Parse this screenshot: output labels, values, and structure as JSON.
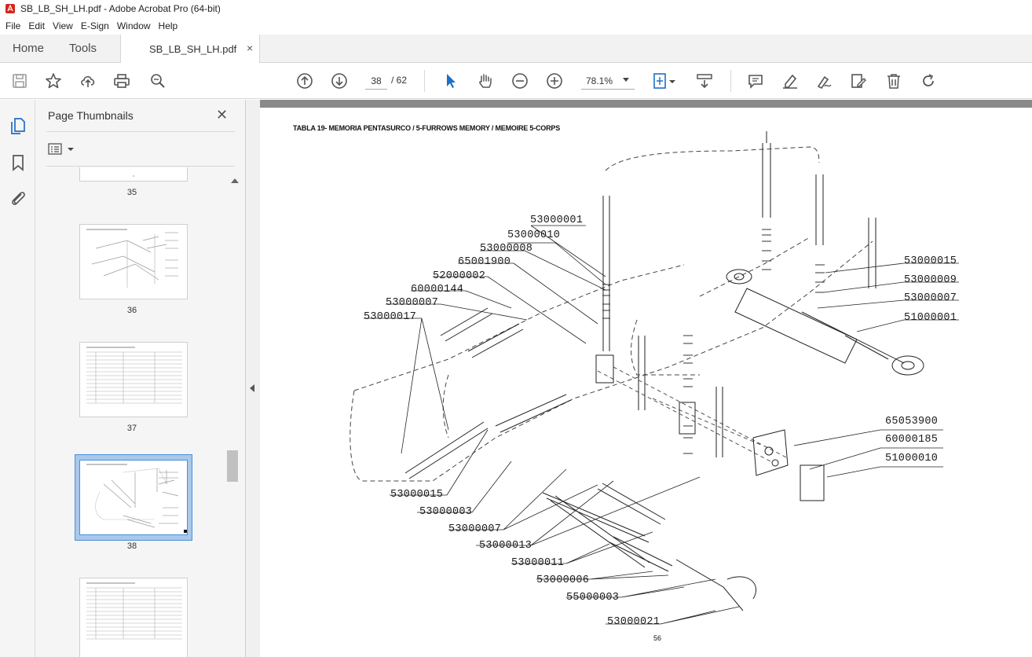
{
  "window": {
    "title": "SB_LB_SH_LH.pdf - Adobe Acrobat Pro (64-bit)"
  },
  "menu": [
    "File",
    "Edit",
    "View",
    "E-Sign",
    "Window",
    "Help"
  ],
  "tabs": {
    "home": "Home",
    "tools": "Tools",
    "document": "SB_LB_SH_LH.pdf",
    "close": "×"
  },
  "toolbar": {
    "current_page": "38",
    "total_pages": "/ 62",
    "zoom": "78.1%"
  },
  "panel": {
    "title": "Page Thumbnails",
    "close": "✕",
    "thumbnails": [
      {
        "label": "35"
      },
      {
        "label": "36"
      },
      {
        "label": "37"
      },
      {
        "label": "38",
        "selected": true
      },
      {
        "label": ""
      }
    ]
  },
  "document": {
    "figure_title": "TABLA 19- MEMORIA PENTASURCO / 5-FURROWS MEMORY / MEMOIRE 5-CORPS",
    "page_number": "56",
    "part_labels": [
      "53000001",
      "53000010",
      "53000008",
      "65001900",
      "52000002",
      "60000144",
      "53000007",
      "53000017",
      "53000015",
      "53000009",
      "53000007",
      "51000001",
      "65053900",
      "60000185",
      "51000010",
      "53000015",
      "53000003",
      "53000007",
      "53000013",
      "53000011",
      "53000006",
      "55000003",
      "53000021"
    ]
  },
  "colors": {
    "accent": "#4a90d9",
    "doc_background": "#8a8a8a",
    "tabbar": "#f2f2f2"
  }
}
